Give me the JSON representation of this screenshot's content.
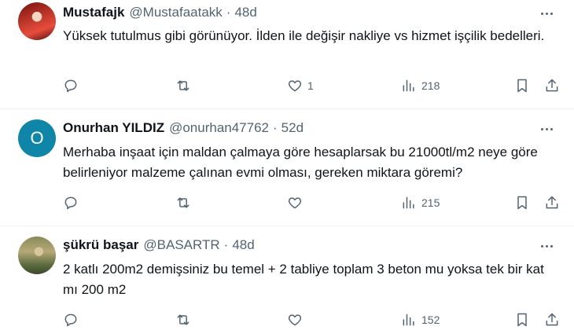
{
  "tweets": [
    {
      "name": "Mustafajk",
      "handle": "@Mustafaatakk",
      "dot": "·",
      "time": "48d",
      "text": "Yüksek tutulmus gibi görünüyor. İlden ile değişir nakliye vs hizmet işçilik bedelleri.",
      "likes": "1",
      "views": "218"
    },
    {
      "name": "Onurhan YILDIZ",
      "handle": "@onurhan47762",
      "dot": "·",
      "time": "52d",
      "avatar_initial": "O",
      "text": "Merhaba inşaat için maldan çalmaya göre hesaplarsak bu 21000tl/m2 neye göre belirleniyor malzeme çalınan evmi olması, gereken miktara göremi?",
      "likes": "",
      "views": "215"
    },
    {
      "name": "şükrü başar",
      "handle": "@BASARTR",
      "dot": "·",
      "time": "48d",
      "text": "2 katlı 200m2 demişsiniz bu temel + 2 tabliye toplam 3 beton mu yoksa tek bir kat mı 200 m2",
      "likes": "",
      "views": "152"
    }
  ],
  "icons": {
    "reply": "reply-icon",
    "retweet": "retweet-icon",
    "like": "heart-icon",
    "views": "views-chart-icon",
    "bookmark": "bookmark-icon",
    "share": "share-icon",
    "more": "more-dots-icon"
  },
  "colors": {
    "text": "#0f1419",
    "secondary": "#536471",
    "divider": "#eff3f4",
    "avatar_initial_bg": "#0f86a8"
  }
}
